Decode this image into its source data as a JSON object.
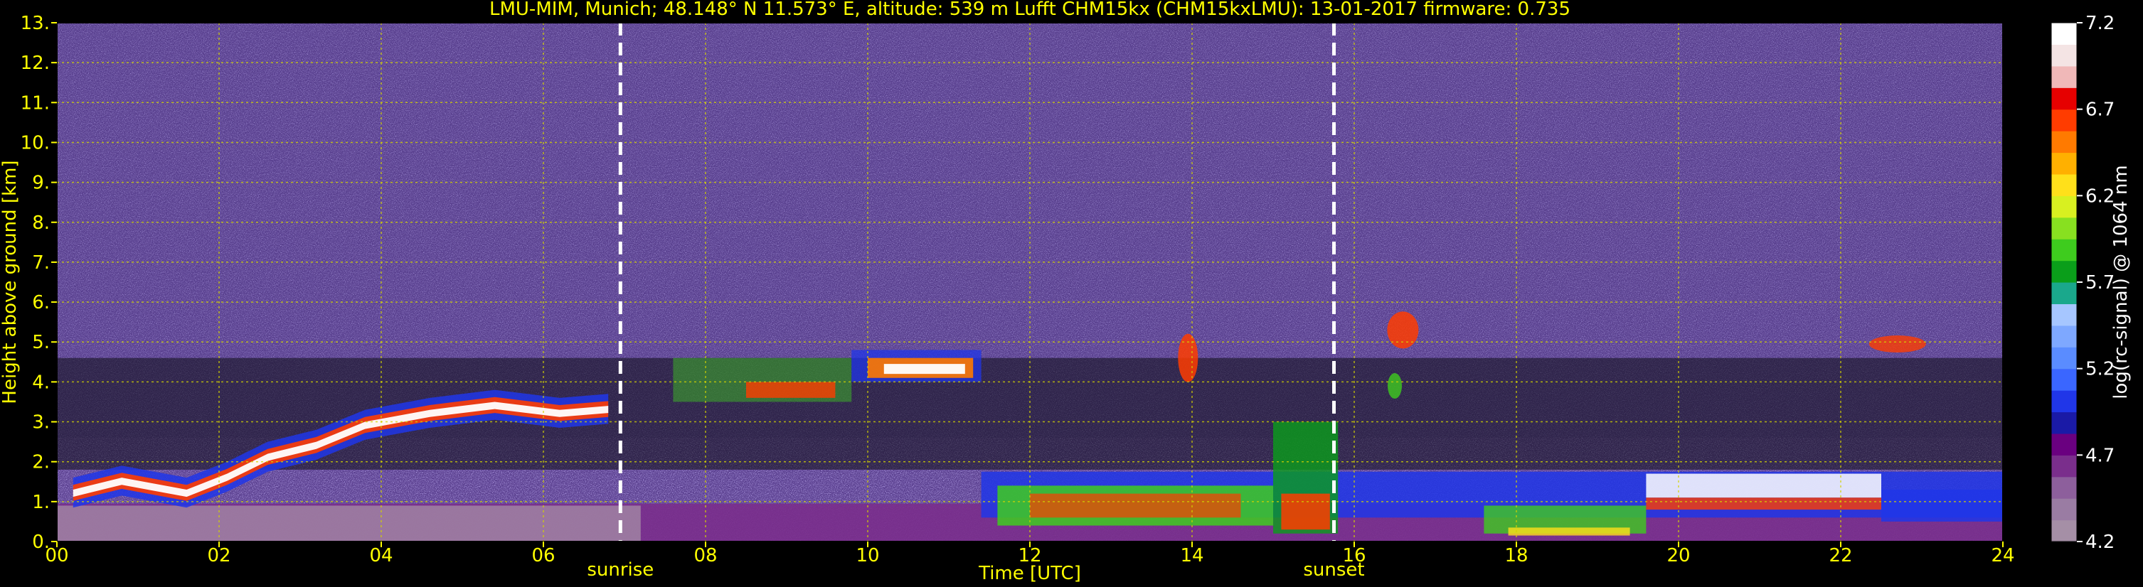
{
  "chart_data": {
    "type": "heatmap",
    "title": "LMU-MIM, Munich; 48.148° N 11.573° E, altitude: 539 m    Lufft CHM15kx (CHM15kxLMU): 13-01-2017    firmware: 0.735",
    "xlabel": "Time [UTC]",
    "ylabel": "Height above ground [km]",
    "xlim": [
      0,
      24
    ],
    "ylim": [
      0,
      13
    ],
    "x_ticks": [
      "00",
      "02",
      "04",
      "06",
      "08",
      "10",
      "12",
      "14",
      "16",
      "18",
      "20",
      "22",
      "24"
    ],
    "y_ticks": [
      "0.",
      "1.",
      "2.",
      "3.",
      "4.",
      "5.",
      "6.",
      "7.",
      "8.",
      "9.",
      "10.",
      "11.",
      "12.",
      "13."
    ],
    "grid": true,
    "colorbar": {
      "label": "log(rc-signal) @ 1064 nm",
      "min": 4.2,
      "max": 7.2,
      "ticks": [
        "4.2",
        "4.7",
        "5.2",
        "5.7",
        "6.2",
        "6.7",
        "7.2"
      ],
      "colors": [
        "#a58fa6",
        "#9a7ca3",
        "#8d5f9c",
        "#7a2e8c",
        "#6a0080",
        "#1a1aa6",
        "#2036e8",
        "#3a66ff",
        "#5a8cff",
        "#7ea8ff",
        "#a6c6ff",
        "#1aa88c",
        "#0a9e1a",
        "#3ecc1e",
        "#88e020",
        "#d8f020",
        "#ffe01a",
        "#ffb000",
        "#ff7a00",
        "#ff3c00",
        "#e60000",
        "#f0b8b8",
        "#f4e4e4",
        "#ffffff"
      ]
    },
    "annotations": [
      {
        "label": "sunrise",
        "x": 6.95
      },
      {
        "label": "sunset",
        "x": 15.75
      }
    ]
  },
  "colors": {
    "text": "#ffff00",
    "background": "#000000",
    "grid": "#d4d400",
    "colorbar_text": "#ffffff"
  }
}
